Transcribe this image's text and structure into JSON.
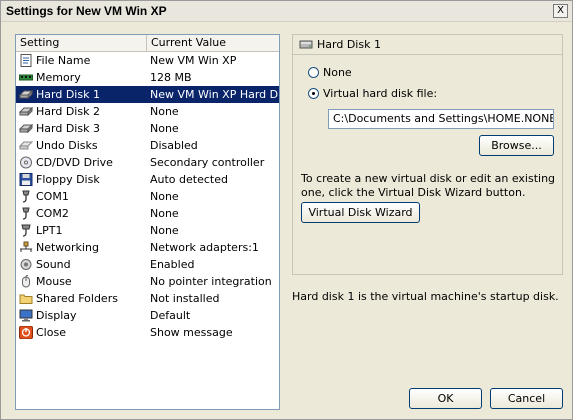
{
  "window": {
    "title": "Settings for New VM Win XP",
    "close_label": "X"
  },
  "list": {
    "header_setting": "Setting",
    "header_value": "Current Value",
    "rows": [
      {
        "name": "File Name",
        "value": "New VM Win XP",
        "icon": "file-icon"
      },
      {
        "name": "Memory",
        "value": "128 MB",
        "icon": "memory-icon"
      },
      {
        "name": "Hard Disk 1",
        "value": "New VM Win XP Hard Disk",
        "icon": "hard-disk-icon",
        "selected": true
      },
      {
        "name": "Hard Disk 2",
        "value": "None",
        "icon": "hard-disk-icon"
      },
      {
        "name": "Hard Disk 3",
        "value": "None",
        "icon": "hard-disk-icon"
      },
      {
        "name": "Undo Disks",
        "value": "Disabled",
        "icon": "undo-disk-icon"
      },
      {
        "name": "CD/DVD Drive",
        "value": "Secondary controller",
        "icon": "cd-icon"
      },
      {
        "name": "Floppy Disk",
        "value": "Auto detected",
        "icon": "floppy-icon"
      },
      {
        "name": "COM1",
        "value": "None",
        "icon": "com-port-icon"
      },
      {
        "name": "COM2",
        "value": "None",
        "icon": "com-port-icon"
      },
      {
        "name": "LPT1",
        "value": "None",
        "icon": "lpt-port-icon"
      },
      {
        "name": "Networking",
        "value": "Network adapters:1",
        "icon": "network-icon"
      },
      {
        "name": "Sound",
        "value": "Enabled",
        "icon": "sound-icon"
      },
      {
        "name": "Mouse",
        "value": "No pointer integration",
        "icon": "mouse-icon"
      },
      {
        "name": "Shared Folders",
        "value": "Not installed",
        "icon": "folder-icon"
      },
      {
        "name": "Display",
        "value": "Default",
        "icon": "display-icon"
      },
      {
        "name": "Close",
        "value": "Show message",
        "icon": "close-power-icon"
      }
    ]
  },
  "panel": {
    "title": "Hard Disk 1",
    "option_none": "None",
    "option_vhd": "Virtual hard disk file:",
    "selected_option": "vhd",
    "path_value": "C:\\Documents and Settings\\HOME.NONE\\Mor",
    "browse_label": "Browse...",
    "info_text": "To create a new virtual disk or edit an existing one, click the Virtual Disk Wizard button.",
    "wizard_label": "Virtual Disk Wizard"
  },
  "footnote": "Hard disk 1 is the virtual machine's startup disk.",
  "buttons": {
    "ok": "OK",
    "cancel": "Cancel"
  },
  "colors": {
    "selection": "#0a246a",
    "background": "#ece9d8",
    "border": "#7f9db9"
  }
}
